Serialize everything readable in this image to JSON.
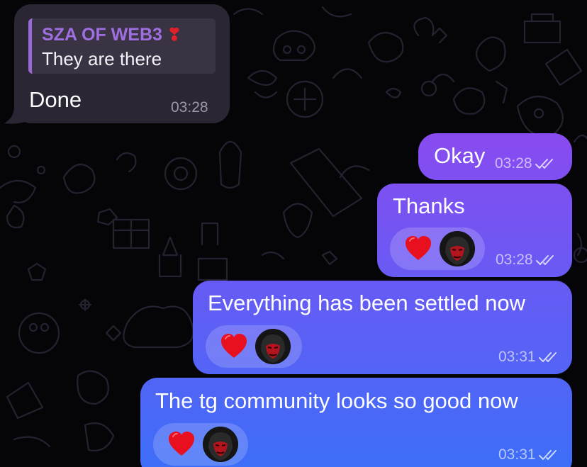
{
  "chat": {
    "messages": [
      {
        "reply_author": "SZA OF WEB3",
        "reply_author_emoji": "❣",
        "reply_text": "They are there",
        "text": "Done",
        "time": "03:28"
      },
      {
        "text": "Okay",
        "time": "03:28"
      },
      {
        "text": "Thanks",
        "time": "03:28",
        "reactions": [
          "heart-emoji",
          "avatar"
        ]
      },
      {
        "text": "Everything has been settled now",
        "time": "03:31",
        "reactions": [
          "heart-emoji",
          "avatar"
        ]
      },
      {
        "text": "The tg community looks so good now",
        "time": "03:31",
        "reactions": [
          "heart-emoji",
          "avatar"
        ]
      }
    ]
  },
  "colors": {
    "background": "#050507",
    "incoming_bubble": "#2b2633",
    "reply_accent": "#9f6ee0",
    "outgoing_gradient_top": "#8a4af0",
    "outgoing_gradient_bottom": "#3d6ef8",
    "heart": "#e8101e"
  },
  "icons": {
    "read_status": "double-check-icon",
    "reaction": "heart-emoji"
  }
}
